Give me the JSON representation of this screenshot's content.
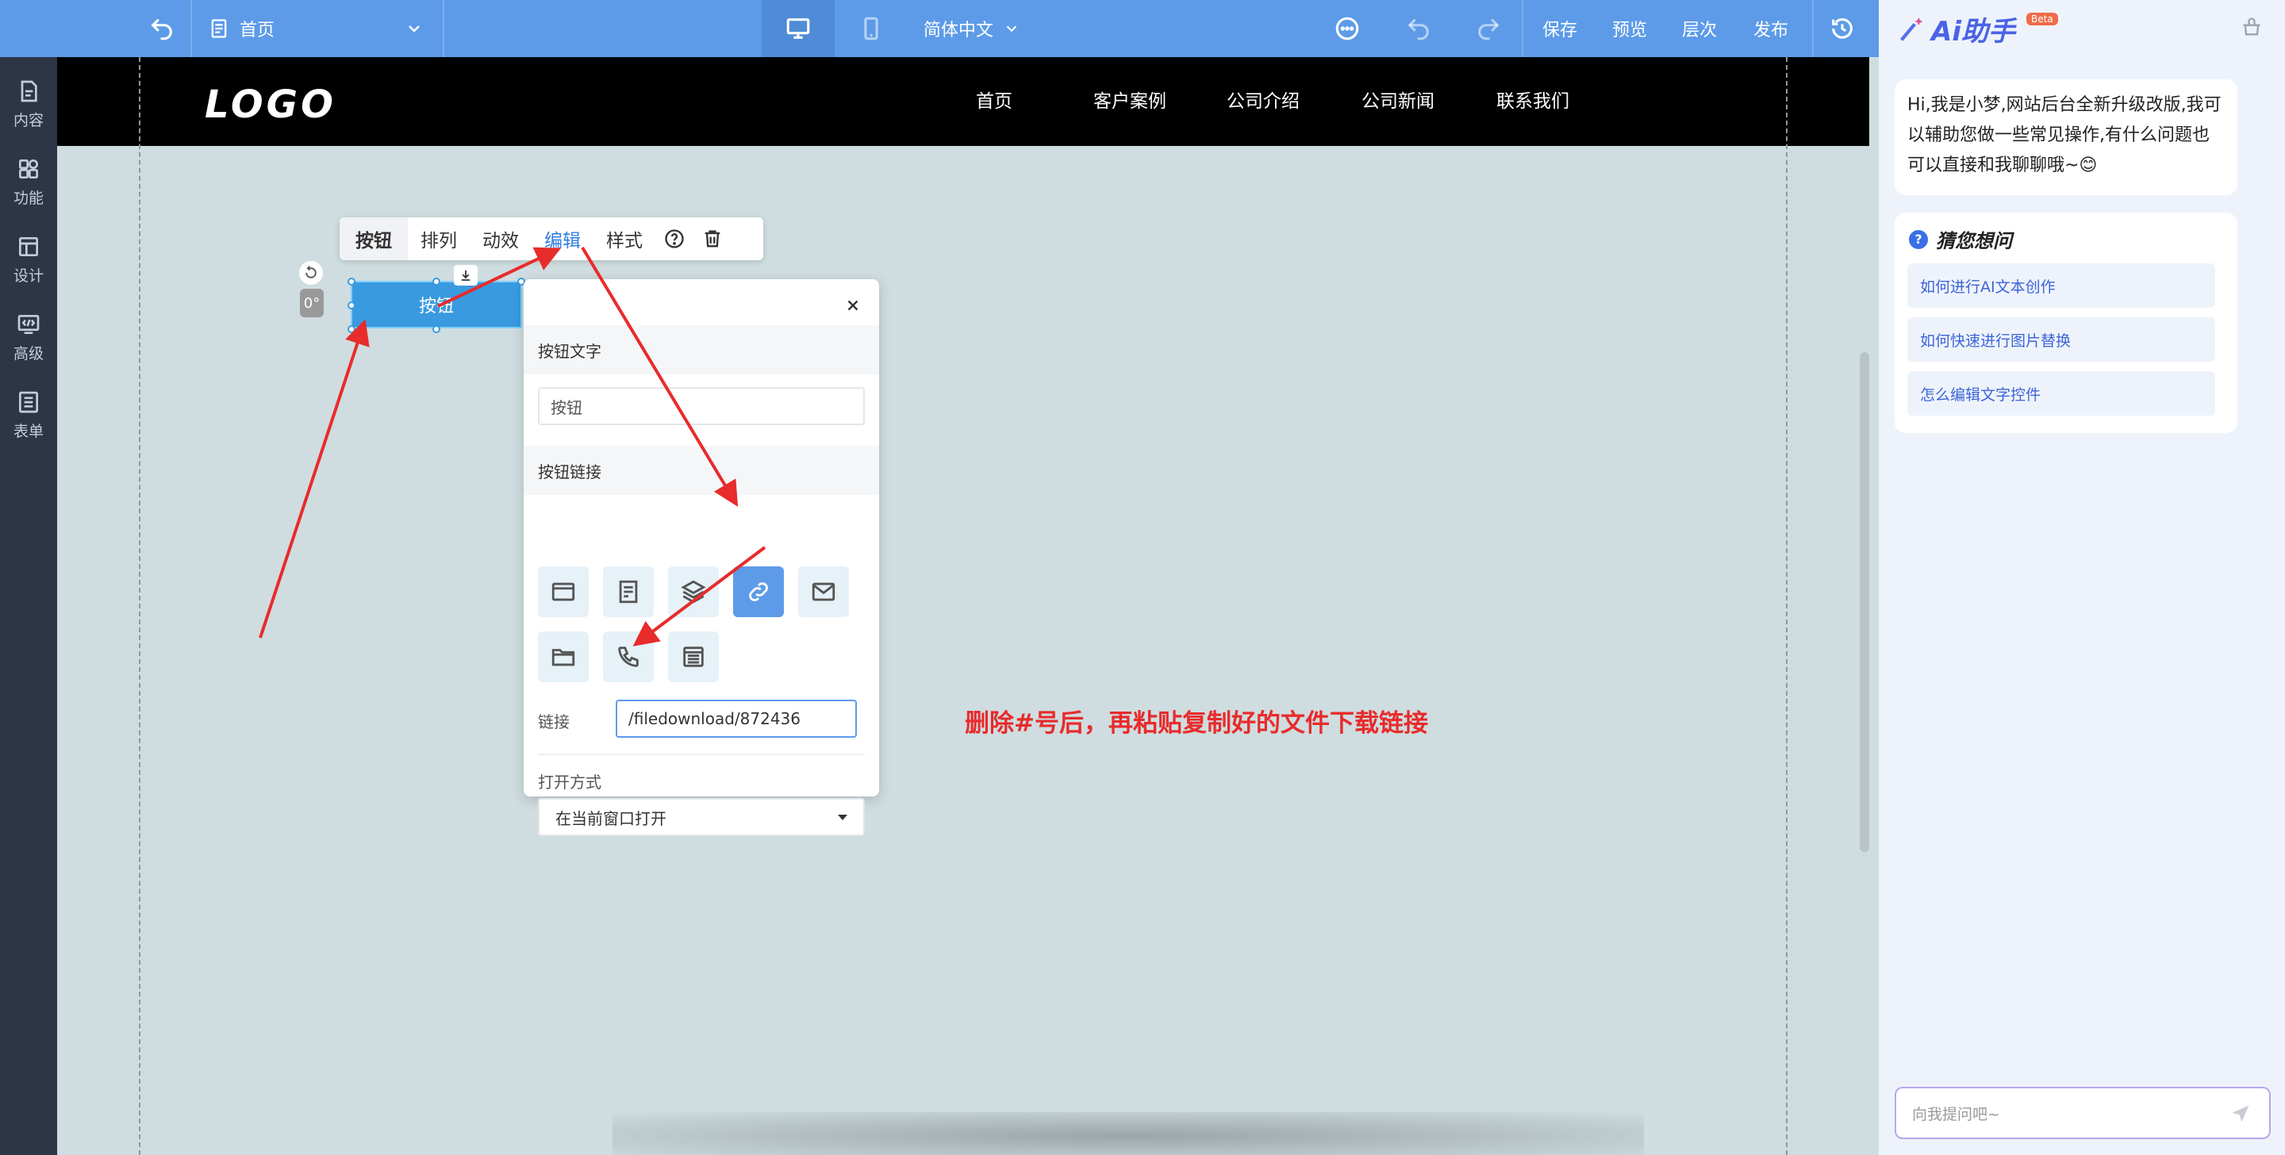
{
  "toolbar": {
    "page_name": "首页",
    "language": "简体中文",
    "save": "保存",
    "preview": "预览",
    "layers": "层次",
    "publish": "发布"
  },
  "sidebar": {
    "items": [
      {
        "label": "内容",
        "icon": "document-icon"
      },
      {
        "label": "功能",
        "icon": "grid-icon"
      },
      {
        "label": "设计",
        "icon": "layout-icon"
      },
      {
        "label": "高级",
        "icon": "code-icon"
      },
      {
        "label": "表单",
        "icon": "list-icon"
      }
    ]
  },
  "site": {
    "logo": "LOGO",
    "nav": [
      "首页",
      "客户案例",
      "公司介绍",
      "公司新闻",
      "联系我们"
    ]
  },
  "element": {
    "button_text": "按钮",
    "angle": "0°"
  },
  "element_toolbar": {
    "items": [
      "按钮",
      "排列",
      "动效",
      "编辑",
      "样式"
    ],
    "active": "编辑"
  },
  "edit_panel": {
    "button_text_label": "按钮文字",
    "button_text_value": "按钮",
    "button_link_label": "按钮链接",
    "link_label": "链接",
    "link_value": "/filedownload/872436",
    "open_mode_label": "打开方式",
    "open_mode_value": "在当前窗口打开"
  },
  "annotation": "删除#号后，再粘贴复制好的文件下载链接",
  "ai": {
    "title": "Ai助手",
    "beta": "Beta",
    "greeting": "Hi,我是小梦,网站后台全新升级改版,我可以辅助您做一些常见操作,有什么问题也可以直接和我聊聊哦~😊",
    "suggest_title": "猜您想问",
    "questions": [
      "如何进行AI文本创作",
      "如何快速进行图片替换",
      "怎么编辑文字控件"
    ],
    "input_placeholder": "向我提问吧~"
  },
  "colors": {
    "toolbar_bg": "#5d9be8",
    "sidebar_bg": "#2d3647",
    "canvas_bg": "#cfdde0",
    "accent": "#2f7de1",
    "annotation": "#e82b2b"
  }
}
